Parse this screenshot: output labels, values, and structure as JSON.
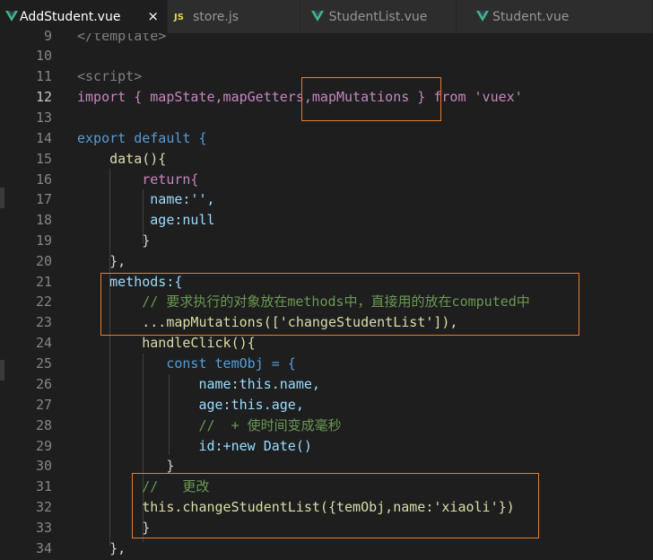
{
  "tabs": [
    {
      "label": "AddStudent.vue",
      "icon": "vue-icon",
      "active": true,
      "close": "×"
    },
    {
      "label": "store.js",
      "icon": "js-icon",
      "active": false
    },
    {
      "label": "StudentList.vue",
      "icon": "vue-icon",
      "active": false
    },
    {
      "label": "Student.vue",
      "icon": "vue-icon",
      "active": false
    }
  ],
  "icons": {
    "js": "JS"
  },
  "line_numbers": [
    "9",
    "10",
    "11",
    "12",
    "13",
    "14",
    "15",
    "16",
    "17",
    "18",
    "19",
    "20",
    "21",
    "22",
    "23",
    "24",
    "25",
    "26",
    "27",
    "28",
    "29",
    "30",
    "31",
    "32",
    "33",
    "34"
  ],
  "current_line": "12",
  "code": [
    "</template>",
    "",
    "<script>",
    "import { mapState,mapGetters,mapMutations } from 'vuex'",
    "",
    "export default {",
    "    data(){",
    "        return{",
    "         name:'',",
    "         age:null",
    "        }",
    "    },",
    "    methods:{",
    "        // 要求执行的对象放在methods中，直接用的放在computed中",
    "        ...mapMutations(['changeStudentList']),",
    "        handleClick(){",
    "           const temObj = {",
    "               name:this.name,",
    "               age:this.age,",
    "               //  + 使时间变成毫秒",
    "               id:+new Date()",
    "           }",
    "        //   更改",
    "        this.changeStudentList({temObj,name:'xiaoli'})",
    "        }",
    "    },"
  ],
  "colors": {
    "highlight_box": "#e87c2e",
    "keyword": "#569cd6",
    "string": "#ce9178",
    "comment": "#6a9955"
  }
}
